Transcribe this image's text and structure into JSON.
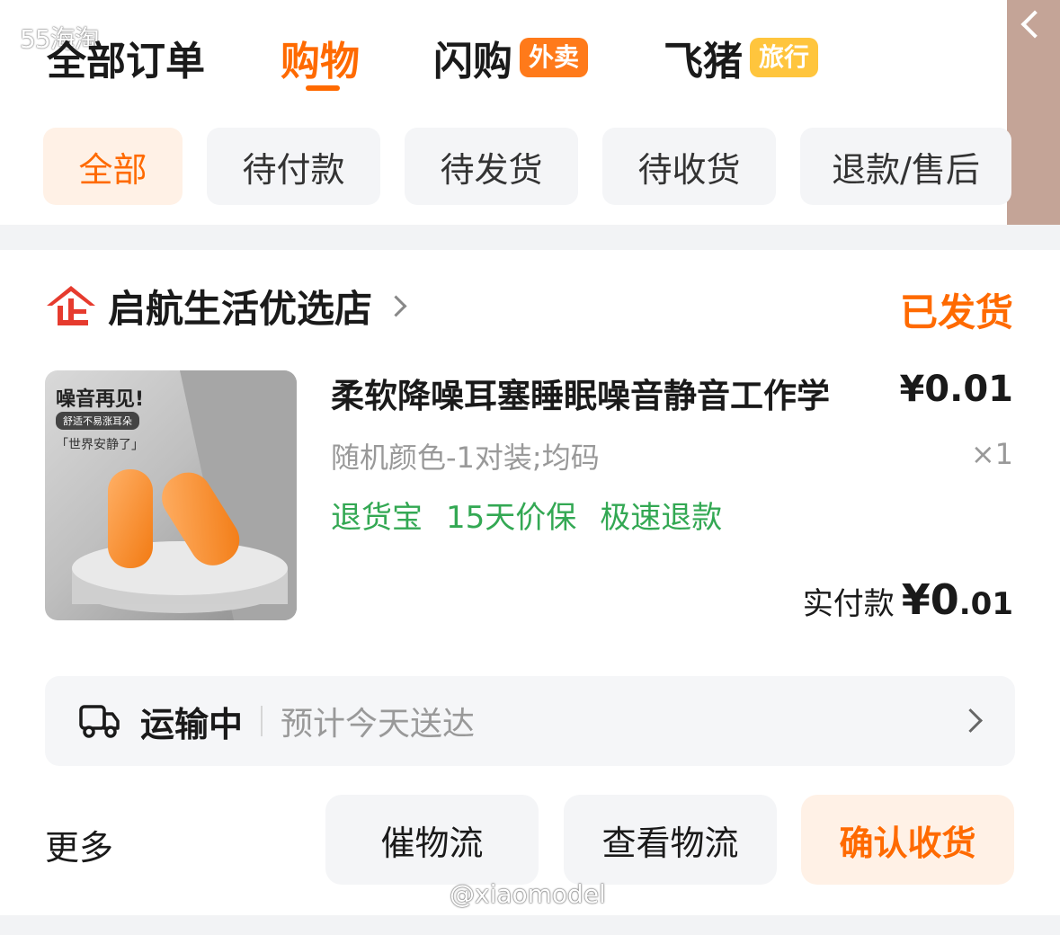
{
  "watermark_top": "55海淘",
  "watermark_bottom": "@xiaomodel",
  "tabs": [
    {
      "label": "全部订单"
    },
    {
      "label": "购物"
    },
    {
      "label": "闪购",
      "tag": "外卖"
    },
    {
      "label": "飞猪",
      "tag": "旅行"
    }
  ],
  "active_tab": "购物",
  "filters": [
    "全部",
    "待付款",
    "待发货",
    "待收货",
    "退款/售后"
  ],
  "active_filter": "全部",
  "store": {
    "name": "启航生活优选店",
    "status": "已发货"
  },
  "product": {
    "title": "柔软降噪耳塞睡眠噪音静音工作学",
    "price": "¥0.01",
    "spec": "随机颜色-1对装;均码",
    "quantity": "×1",
    "service_tags": [
      "退货宝",
      "15天价保",
      "极速退款"
    ],
    "image_text": {
      "headline": "噪音再见!",
      "pill": "舒适不易涨耳朵",
      "quote": "「世界安静了」"
    }
  },
  "payment": {
    "label": "实付款",
    "currency_integer": "¥0",
    "decimal": ".01"
  },
  "logistics": {
    "status": "运输中",
    "eta": "预计今天送达"
  },
  "actions": {
    "more": "更多",
    "urge": "催物流",
    "track": "查看物流",
    "confirm": "确认收货"
  },
  "colors": {
    "accent": "#ff6a00",
    "service_green": "#33a853",
    "muted": "#999999",
    "chip_bg": "#f4f5f7",
    "back_panel": "#c4a497"
  }
}
